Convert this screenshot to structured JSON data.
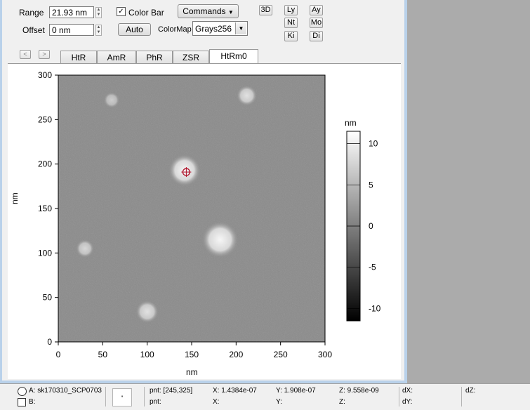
{
  "controls": {
    "range_label": "Range",
    "range_value": "21.93 nm",
    "offset_label": "Offset",
    "offset_value": "0 nm",
    "colorbar_label": "Color Bar",
    "colorbar_checked": true,
    "commands_label": "Commands",
    "auto_label": "Auto",
    "colormap_label": "ColorMap",
    "colormap_value": "Grays256"
  },
  "mini_buttons": [
    "3D",
    "Ly",
    "Ay",
    "Nt",
    "Mo",
    "Ki",
    "Di"
  ],
  "tabs": {
    "prev": "<",
    "next": ">",
    "items": [
      "HtR",
      "AmR",
      "PhR",
      "ZSR",
      "HtRm0"
    ],
    "active": "HtRm0"
  },
  "chart_data": {
    "type": "heatmap",
    "title": "",
    "xlabel": "nm",
    "ylabel": "nm",
    "xlim": [
      0,
      300
    ],
    "ylim": [
      0,
      300
    ],
    "xticks": [
      0,
      50,
      100,
      150,
      200,
      250,
      300
    ],
    "yticks": [
      0,
      50,
      100,
      150,
      200,
      250,
      300
    ],
    "colormap": "Grays256",
    "colorbar": {
      "label": "nm",
      "range": [
        -11.5,
        11.5
      ],
      "ticks": [
        10,
        5,
        0,
        -5,
        -10
      ]
    },
    "features": [
      {
        "x": 142,
        "y": 193,
        "r": 14,
        "height": 9
      },
      {
        "x": 182,
        "y": 115,
        "r": 16,
        "height": 7
      },
      {
        "x": 100,
        "y": 34,
        "r": 10,
        "height": 5
      },
      {
        "x": 212,
        "y": 277,
        "r": 9,
        "height": 5
      },
      {
        "x": 30,
        "y": 105,
        "r": 8,
        "height": 4
      },
      {
        "x": 60,
        "y": 272,
        "r": 7,
        "height": 3
      }
    ],
    "cursor": {
      "x": 144,
      "y": 191
    }
  },
  "status": {
    "a_label": "A: sk170310_SCP0703",
    "b_label": "B:",
    "pnt_a": "pnt: [245,325]",
    "x_a": "X: 1.4384e-07",
    "y_a": "Y: 1.908e-07",
    "z_a": "Z: 9.558e-09",
    "pnt_b": "pnt:",
    "x_b": "X:",
    "y_b": "Y:",
    "z_b": "Z:",
    "dx": "dX:",
    "dy": "dY:",
    "dz": "dZ:"
  },
  "colors": {
    "window_border": "#b9d1ea",
    "panel": "#f0f0f0",
    "cursor": "#b0122a"
  }
}
